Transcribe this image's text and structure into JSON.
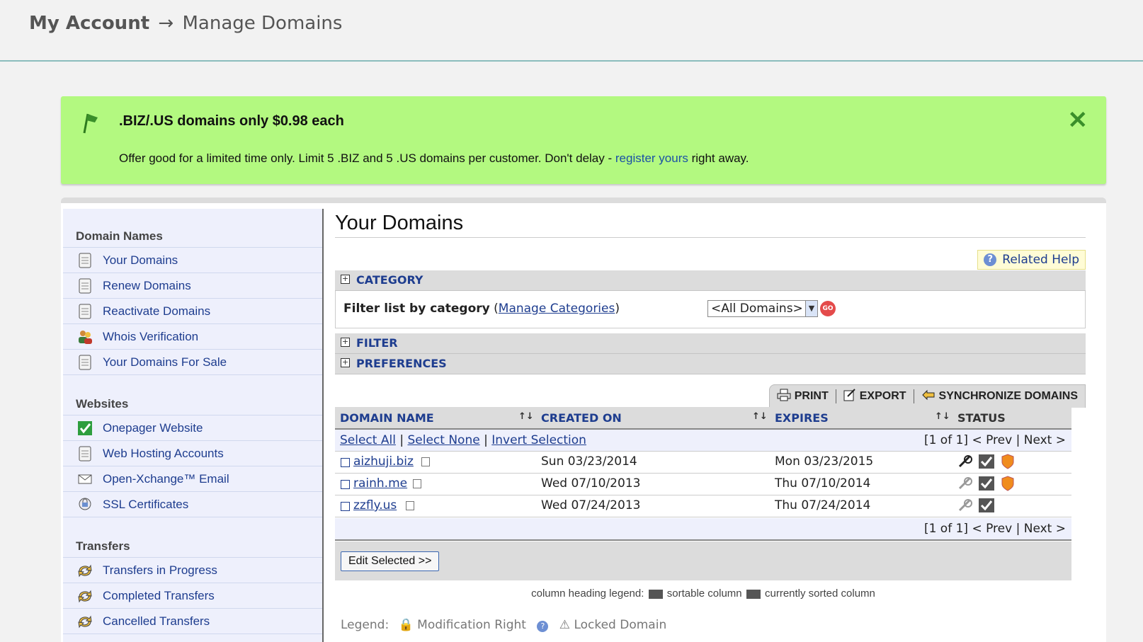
{
  "breadcrumb": {
    "root": "My Account",
    "arrow": "→",
    "current": "Manage Domains"
  },
  "promo": {
    "title": ".BIZ/.US domains only $0.98 each",
    "text_before": "Offer good for a limited time only. Limit 5 .BIZ and 5 .US domains per customer. Don't delay - ",
    "link": "register yours",
    "text_after": " right away.",
    "close": "✕"
  },
  "sidebar": {
    "sections": [
      {
        "heading": "Domain Names",
        "items": [
          "Your Domains",
          "Renew Domains",
          "Reactivate Domains",
          "Whois Verification",
          "Your Domains For Sale"
        ]
      },
      {
        "heading": "Websites",
        "items": [
          "Onepager Website",
          "Web Hosting Accounts",
          "Open-Xchange™ Email",
          "SSL Certificates"
        ]
      },
      {
        "heading": "Transfers",
        "items": [
          "Transfers in Progress",
          "Completed Transfers",
          "Cancelled Transfers"
        ]
      }
    ]
  },
  "main": {
    "title": "Your Domains",
    "related_help": "Related Help",
    "category": {
      "label": "CATEGORY",
      "filter_label": "Filter list by category",
      "manage_link": "Manage Categories",
      "select_value": "<All Domains>",
      "go": "GO"
    },
    "filter_label": "FILTER",
    "preferences_label": "PREFERENCES",
    "toolbar": {
      "print": "PRINT",
      "export": "EXPORT",
      "sync": "SYNCHRONIZE DOMAINS"
    },
    "columns": {
      "domain": "DOMAIN NAME",
      "created": "CREATED ON",
      "expires": "EXPIRES",
      "status": "STATUS",
      "sort_glyph": "↑↓"
    },
    "selection": {
      "all": "Select All",
      "none": "Select None",
      "invert": "Invert Selection"
    },
    "pager": {
      "count": "[1 of 1]",
      "prev": "< Prev",
      "next": "Next >"
    },
    "domains": [
      {
        "name": "aizhuji.biz",
        "created": "Sun 03/23/2014",
        "expires": "Mon 03/23/2015",
        "flag": true
      },
      {
        "name": "rainh.me",
        "created": "Wed 07/10/2013",
        "expires": "Thu 07/10/2014",
        "flag": true
      },
      {
        "name": "zzfly.us",
        "created": "Wed 07/24/2013",
        "expires": "Thu 07/24/2014",
        "flag": false
      }
    ],
    "edit_button": "Edit Selected >>",
    "column_legend": {
      "label": "column heading legend:",
      "sortable": "sortable column",
      "sorted": "currently sorted column"
    },
    "legend": {
      "label": "Legend:",
      "modification": "Modification Right",
      "locked": "Locked Domain"
    }
  },
  "colors": {
    "promo_bg": "#b3f980",
    "link": "#1e3d8f",
    "sidebar_bg": "#eef0fc"
  }
}
